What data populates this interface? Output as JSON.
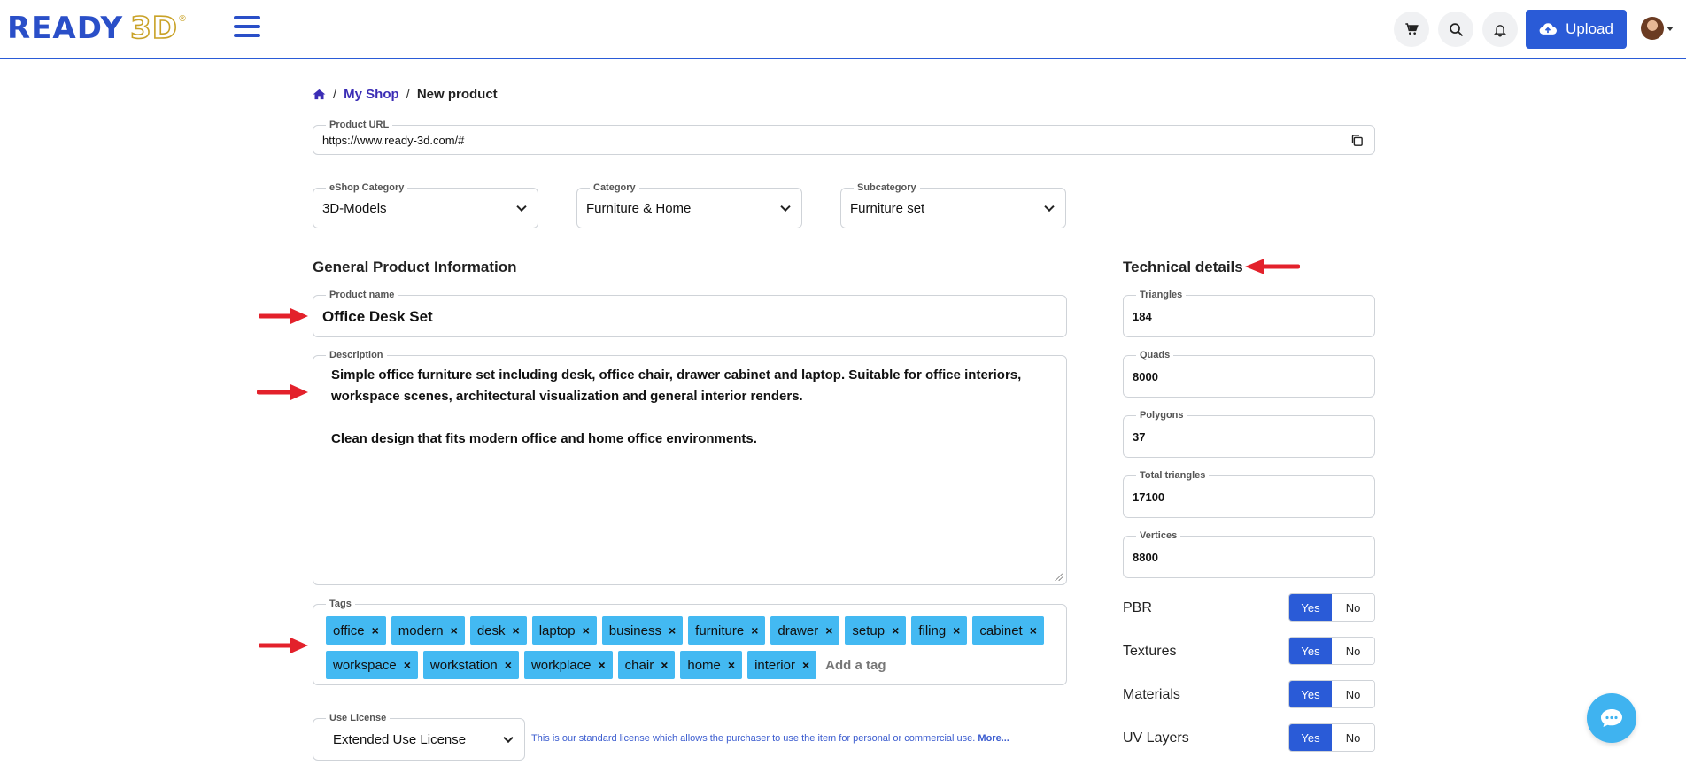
{
  "header": {
    "logo_ready": "READY",
    "logo_3d": "3D",
    "logo_reg": "®",
    "upload_label": "Upload",
    "icons": [
      "cart-icon",
      "search-icon",
      "bell-icon",
      "cloud-upload-icon"
    ]
  },
  "breadcrumb": {
    "home_icon": "home-icon",
    "shop": "My Shop",
    "current": "New product",
    "sep": "/"
  },
  "product_url": {
    "label": "Product URL",
    "value": "https://www.ready-3d.com/#"
  },
  "selects": {
    "eshop": {
      "label": "eShop Category",
      "value": "3D-Models"
    },
    "category": {
      "label": "Category",
      "value": "Furniture & Home"
    },
    "subcategory": {
      "label": "Subcategory",
      "value": "Furniture set"
    }
  },
  "general": {
    "title": "General Product Information",
    "name_label": "Product name",
    "name_value": "Office Desk Set",
    "desc_label": "Description",
    "desc_value": "Simple office furniture set including desk, office chair, drawer cabinet and laptop. Suitable for office interiors, workspace scenes, architectural visualization and general interior renders.\n\nClean design that fits modern office and home office environments.",
    "tags_label": "Tags",
    "tags": [
      "office",
      "modern",
      "desk",
      "laptop",
      "business",
      "furniture",
      "drawer",
      "setup",
      "filing",
      "cabinet",
      "workspace",
      "workstation",
      "workplace",
      "chair",
      "home",
      "interior"
    ],
    "tag_remove": "×",
    "tag_placeholder": "Add a tag"
  },
  "license": {
    "label": "Use License",
    "value": "Extended Use License",
    "note": "This is our standard license which allows the purchaser to use the item for personal or commercial use.",
    "more": "More..."
  },
  "technical": {
    "title": "Technical details",
    "fields": [
      {
        "label": "Triangles",
        "value": "184"
      },
      {
        "label": "Quads",
        "value": "8000"
      },
      {
        "label": "Polygons",
        "value": "37"
      },
      {
        "label": "Total triangles",
        "value": "17100"
      },
      {
        "label": "Vertices",
        "value": "8800"
      }
    ],
    "toggles": [
      {
        "label": "PBR",
        "yes": "Yes",
        "no": "No",
        "selected": "Yes"
      },
      {
        "label": "Textures",
        "yes": "Yes",
        "no": "No",
        "selected": "Yes"
      },
      {
        "label": "Materials",
        "yes": "Yes",
        "no": "No",
        "selected": "Yes"
      },
      {
        "label": "UV Layers",
        "yes": "Yes",
        "no": "No",
        "selected": "Yes"
      }
    ]
  },
  "colors": {
    "brand_blue": "#2a5bd7",
    "tag_blue": "#43b9f2",
    "annotation_red": "#e3212b"
  }
}
